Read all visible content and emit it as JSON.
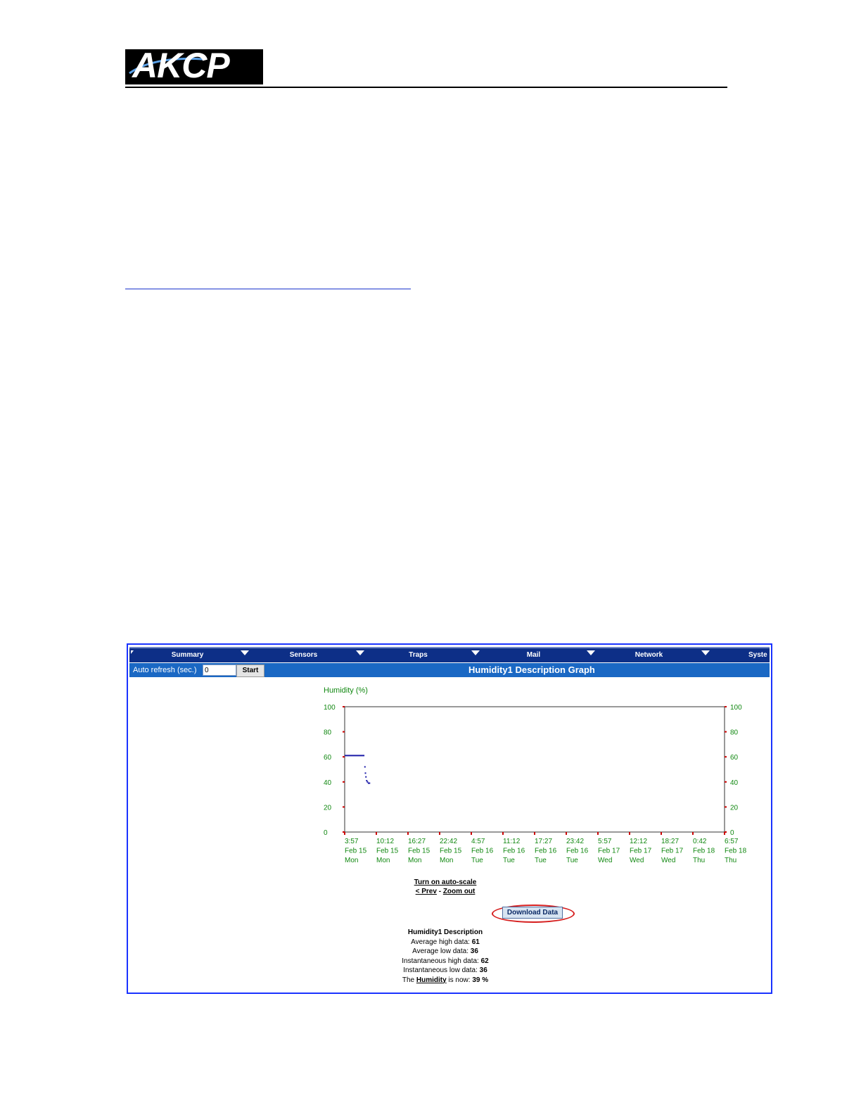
{
  "logo": {
    "text": "AKCP"
  },
  "nav": {
    "items": [
      "Summary",
      "Sensors",
      "Traps",
      "Mail",
      "Network",
      "System"
    ],
    "visible_last": "Syste"
  },
  "toolbar": {
    "refresh_label": "Auto refresh (sec.)",
    "refresh_value": "0",
    "start_label": "Start",
    "graph_title": "Humidity1 Description Graph"
  },
  "chart_data": {
    "type": "line",
    "ylabel": "Humidity (%)",
    "ylim": [
      0,
      100
    ],
    "yticks": [
      "0",
      "20",
      "40",
      "60",
      "80",
      "100"
    ],
    "xticks": [
      [
        "3:57",
        "Feb 15",
        "Mon"
      ],
      [
        "10:12",
        "Feb 15",
        "Mon"
      ],
      [
        "16:27",
        "Feb 15",
        "Mon"
      ],
      [
        "22:42",
        "Feb 15",
        "Mon"
      ],
      [
        "4:57",
        "Feb 16",
        "Tue"
      ],
      [
        "11:12",
        "Feb 16",
        "Tue"
      ],
      [
        "17:27",
        "Feb 16",
        "Tue"
      ],
      [
        "23:42",
        "Feb 16",
        "Tue"
      ],
      [
        "5:57",
        "Feb 17",
        "Wed"
      ],
      [
        "12:12",
        "Feb 17",
        "Wed"
      ],
      [
        "18:27",
        "Feb 17",
        "Wed"
      ],
      [
        "0:42",
        "Feb 18",
        "Thu"
      ],
      [
        "6:57",
        "Feb 18",
        "Thu"
      ]
    ],
    "series": [
      {
        "color": "#1a1aa8",
        "x_hours": [
          0,
          0.5,
          1,
          1.5,
          2,
          2.5,
          3,
          3.5,
          3.9,
          4.0,
          4.1,
          4.2,
          4.35,
          4.5,
          4.7,
          4.9
        ],
        "values": [
          61,
          61,
          61,
          61,
          61,
          61,
          61,
          61,
          61,
          52,
          47,
          44,
          41,
          40,
          39,
          39
        ]
      }
    ],
    "grid": false,
    "axis_color": "#cc0000",
    "label_color": "#118811"
  },
  "links": {
    "autoscale": "Turn on auto-scale",
    "prev": "< Prev",
    "separator": " - ",
    "zoom_out": "Zoom out",
    "download": "Download Data"
  },
  "stats": {
    "title": "Humidity1 Description",
    "avg_high_label": "Average high data: ",
    "avg_high_value": "61",
    "avg_low_label": "Average low data: ",
    "avg_low_value": "36",
    "inst_high_label": "Instantaneous high data: ",
    "inst_high_value": "62",
    "inst_low_label": "Instantaneous low data: ",
    "inst_low_value": "36",
    "now_prefix": "The ",
    "now_link": "Humidity",
    "now_mid": " is now: ",
    "now_value": "39 %"
  }
}
